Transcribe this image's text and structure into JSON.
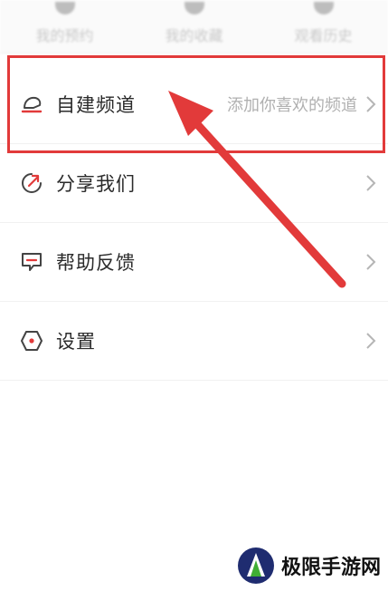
{
  "quick_actions": [
    {
      "label": "我的预约",
      "icon": "reservation-icon"
    },
    {
      "label": "我的收藏",
      "icon": "favorites-icon"
    },
    {
      "label": "观看历史",
      "icon": "history-icon"
    }
  ],
  "menu": [
    {
      "label": "自建频道",
      "hint": "添加你喜欢的频道",
      "icon": "channel-icon"
    },
    {
      "label": "分享我们",
      "hint": "",
      "icon": "share-icon"
    },
    {
      "label": "帮助反馈",
      "hint": "",
      "icon": "feedback-icon"
    },
    {
      "label": "设置",
      "hint": "",
      "icon": "settings-icon"
    }
  ],
  "annotation": {
    "color": "#e23a3a"
  },
  "watermark": {
    "text": "极限手游网"
  }
}
